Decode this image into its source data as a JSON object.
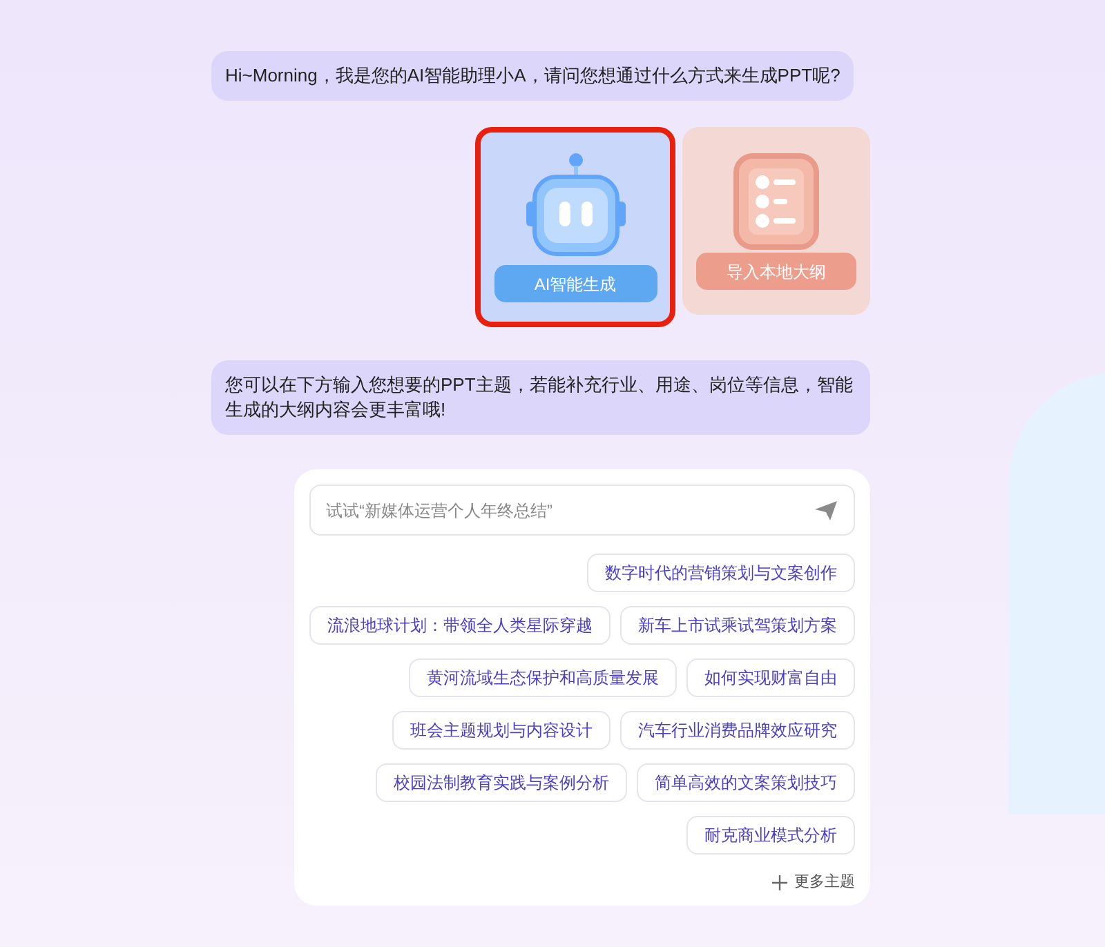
{
  "greeting": "Hi~Morning，我是您的AI智能助理小A，请问您想通过什么方式来生成PPT呢?",
  "modes": [
    {
      "kind": "robot",
      "label": "AI智能生成",
      "selected": true
    },
    {
      "kind": "outline",
      "label": "导入本地大纲",
      "selected": false
    }
  ],
  "hint": "您可以在下方输入您想要的PPT主题，若能补充行业、用途、岗位等信息，智能生成的大纲内容会更丰富哦!",
  "input": {
    "placeholder": "试试“新媒体运营个人年终总结”"
  },
  "topic_rows": [
    [
      "数字时代的营销策划与文案创作"
    ],
    [
      "流浪地球计划：带领全人类星际穿越",
      "新车上市试乘试驾策划方案"
    ],
    [
      "黄河流域生态保护和高质量发展",
      "如何实现财富自由"
    ],
    [
      "班会主题规划与内容设计",
      "汽车行业消费品牌效应研究"
    ],
    [
      "校园法制教育实践与案例分析",
      "简单高效的文案策划技巧"
    ],
    [
      "耐克商业模式分析"
    ]
  ],
  "more": "更多主题"
}
